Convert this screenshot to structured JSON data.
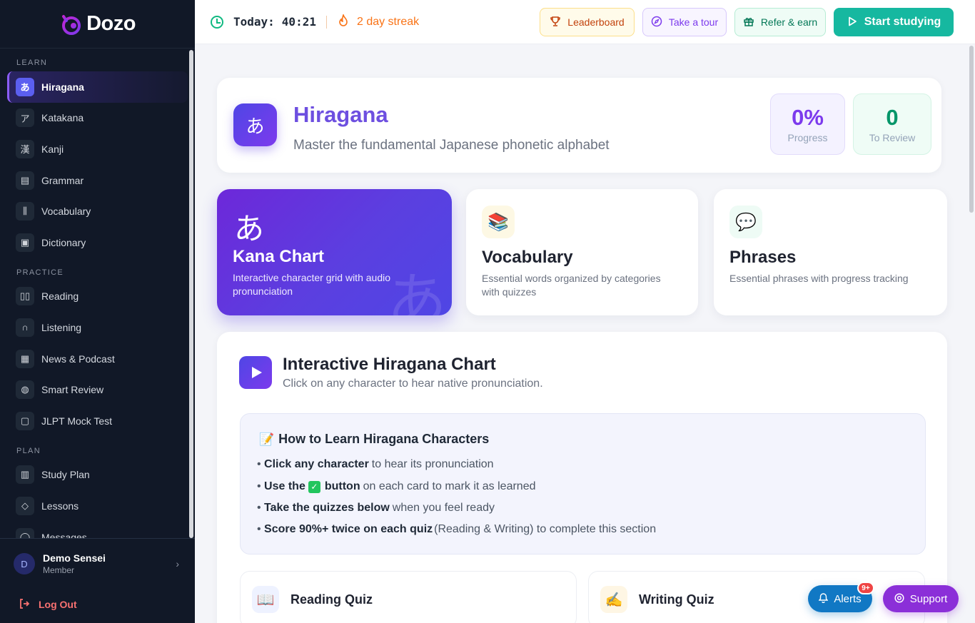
{
  "brand": {
    "name": "Dozo"
  },
  "sidebar": {
    "sections": [
      {
        "label": "LEARN",
        "items": [
          {
            "label": "Hiragana",
            "icon": "あ",
            "active": true
          },
          {
            "label": "Katakana",
            "icon": "ア"
          },
          {
            "label": "Kanji",
            "icon": "漢"
          },
          {
            "label": "Grammar",
            "icon": "▤"
          },
          {
            "label": "Vocabulary",
            "icon": "⫼"
          },
          {
            "label": "Dictionary",
            "icon": "▣"
          }
        ]
      },
      {
        "label": "PRACTICE",
        "items": [
          {
            "label": "Reading",
            "icon": "▯▯"
          },
          {
            "label": "Listening",
            "icon": "∩"
          },
          {
            "label": "News & Podcast",
            "icon": "▦"
          },
          {
            "label": "Smart Review",
            "icon": "◍"
          },
          {
            "label": "JLPT Mock Test",
            "icon": "▢"
          }
        ]
      },
      {
        "label": "PLAN",
        "items": [
          {
            "label": "Study Plan",
            "icon": "▥"
          },
          {
            "label": "Lessons",
            "icon": "◇"
          },
          {
            "label": "Messages",
            "icon": "◯"
          }
        ]
      }
    ],
    "user": {
      "initial": "D",
      "name": "Demo Sensei",
      "role": "Member"
    },
    "logout_label": "Log Out"
  },
  "topbar": {
    "today_label": "Today:",
    "today_time": "40:21",
    "streak": "2 day streak",
    "buttons": {
      "leaderboard": "Leaderboard",
      "tour": "Take a tour",
      "refer": "Refer & earn",
      "start": "Start studying"
    }
  },
  "hero": {
    "icon": "あ",
    "title": "Hiragana",
    "subtitle": "Master the fundamental Japanese phonetic alphabet",
    "progress_value": "0%",
    "progress_label": "Progress",
    "review_value": "0",
    "review_label": "To Review"
  },
  "cards": {
    "kana": {
      "glyph": "あ",
      "title": "Kana Chart",
      "desc": "Interactive character grid with audio pronunciation"
    },
    "vocab": {
      "icon": "📚",
      "title": "Vocabulary",
      "desc": "Essential words organized by categories with quizzes"
    },
    "phrases": {
      "icon": "💬",
      "title": "Phrases",
      "desc": "Essential phrases with progress tracking"
    }
  },
  "chart_section": {
    "title": "Interactive Hiragana Chart",
    "subtitle": "Click on any character to hear native pronunciation.",
    "howto": {
      "icon": "📝",
      "title": "How to Learn Hiragana Characters",
      "b1_bold": "Click any character",
      "b1_rest": "to hear its pronunciation",
      "b2_bold_a": "Use the",
      "b2_bold_b": "button",
      "b2_rest": "on each card to mark it as learned",
      "b3_bold": "Take the quizzes below",
      "b3_rest": "when you feel ready",
      "b4_bold": "Score 90%+ twice on each quiz",
      "b4_rest": "(Reading & Writing) to complete this section"
    },
    "quizzes": {
      "reading": {
        "icon": "📖",
        "label": "Reading Quiz"
      },
      "writing": {
        "icon": "✍️",
        "label": "Writing Quiz"
      }
    }
  },
  "floating": {
    "alerts": "Alerts",
    "alerts_badge": "9+",
    "support": "Support"
  },
  "colors": {
    "accent": "#6d4fe0",
    "sidebar_bg": "#111827",
    "start_button": "#16b8a0",
    "streak": "#f97316"
  }
}
